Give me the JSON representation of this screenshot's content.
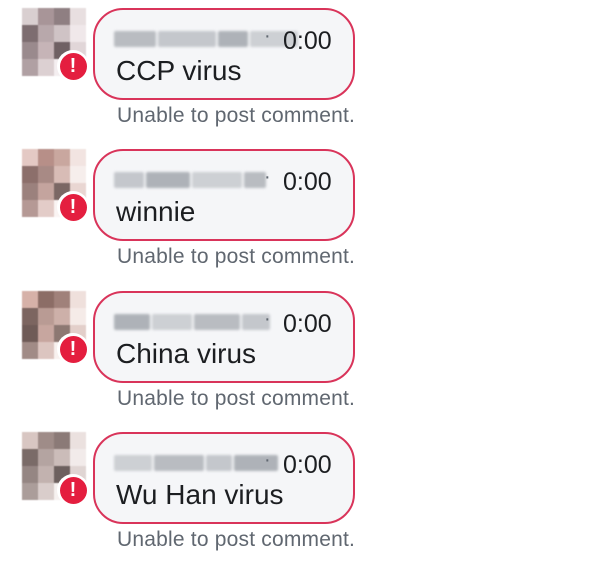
{
  "colors": {
    "error": "#e41e3f",
    "bubble_border": "#d9345a",
    "bubble_background": "#f5f6f8",
    "secondary_text": "#606770",
    "primary_text": "#1c1e21"
  },
  "comments": [
    {
      "author": "",
      "separator": "·",
      "timestamp": "0:00",
      "text": "CCP virus",
      "status": "Unable to post comment.",
      "status_icon": "exclamation-icon",
      "status_glyph": "!"
    },
    {
      "author": "",
      "separator": "·",
      "timestamp": "0:00",
      "text": "winnie",
      "status": "Unable to post comment.",
      "status_icon": "exclamation-icon",
      "status_glyph": "!"
    },
    {
      "author": "",
      "separator": "·",
      "timestamp": "0:00",
      "text": "China virus",
      "status": "Unable to post comment.",
      "status_icon": "exclamation-icon",
      "status_glyph": "!"
    },
    {
      "author": "",
      "separator": "·",
      "timestamp": "0:00",
      "text": "Wu Han virus",
      "status": "Unable to post comment.",
      "status_icon": "exclamation-icon",
      "status_glyph": "!"
    }
  ]
}
